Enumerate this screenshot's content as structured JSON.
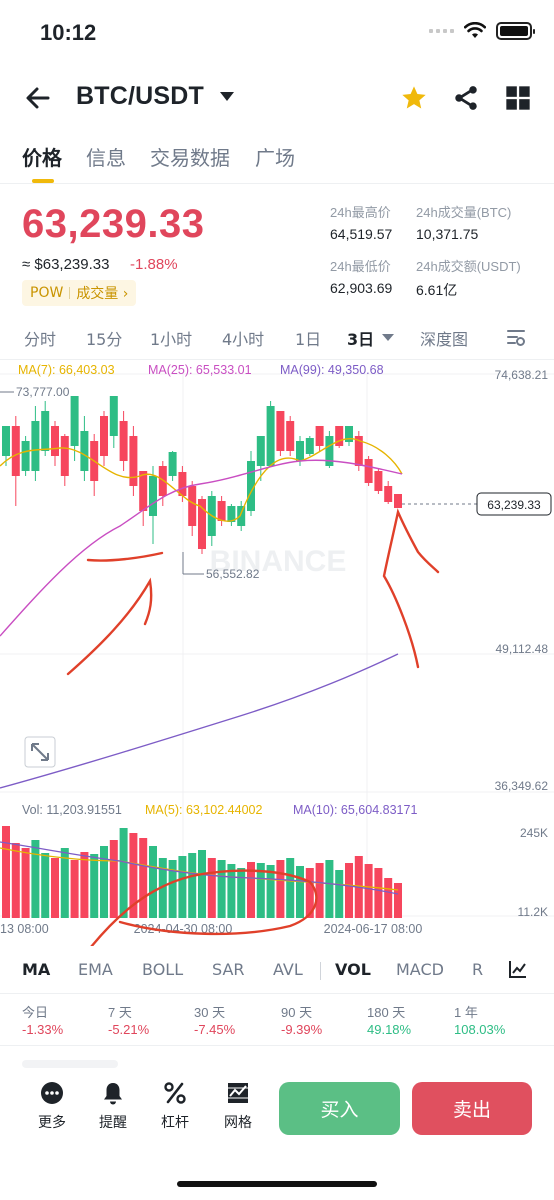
{
  "status": {
    "time": "10:12"
  },
  "header": {
    "pair": "BTC/USDT",
    "star_color": "#f0b90b"
  },
  "tabs": [
    {
      "label": "价格",
      "active": true
    },
    {
      "label": "信息"
    },
    {
      "label": "交易数据"
    },
    {
      "label": "广场"
    }
  ],
  "price": {
    "last": "63,239.33",
    "usd": "≈ $63,239.33",
    "change": "-1.88%",
    "badge_pow": "POW",
    "badge_volume": "成交量 ›",
    "high_label": "24h最高价",
    "high": "64,519.57",
    "low_label": "24h最低价",
    "low": "62,903.69",
    "vol_btc_label": "24h成交量(BTC)",
    "vol_btc": "10,371.75",
    "vol_usdt_label": "24h成交额(USDT)",
    "vol_usdt": "6.61亿"
  },
  "intervals": [
    "分时",
    "15分",
    "1小时",
    "4小时",
    "1日",
    "3日",
    "深度图"
  ],
  "chart": {
    "ma7": "MA(7): 66,403.03",
    "ma25": "MA(25): 65,533.01",
    "ma99": "MA(99): 49,350.68",
    "axis_top": "74,638.21",
    "axis_mid": "49,112.48",
    "axis_bottom": "36,349.62",
    "high_marker": "73,777.00",
    "low_marker": "56,552.82",
    "current": "63,239.33",
    "watermark": "BINANCE",
    "vol": "Vol: 11,203.91551",
    "vol_ma5": "MA(5): 63,102.44002",
    "vol_ma10": "MA(10): 65,604.83171",
    "vol_axis_top": "245K",
    "vol_axis_bottom": "11.2K",
    "date1": "13 08:00",
    "date2": "2024-04-30 08:00",
    "date3": "2024-06-17 08:00",
    "colors": {
      "up": "#2ebd85",
      "down": "#f6465d",
      "ma7": "#e6b400",
      "ma25": "#c94ec2",
      "ma99": "#7d5cc6",
      "annotation": "#e0402a"
    }
  },
  "indicators": [
    "MA",
    "EMA",
    "BOLL",
    "SAR",
    "AVL",
    "VOL",
    "MACD",
    "R"
  ],
  "performance": [
    {
      "label": "今日",
      "value": "-1.33%"
    },
    {
      "label": "7 天",
      "value": "-5.21%"
    },
    {
      "label": "30 天",
      "value": "-7.45%"
    },
    {
      "label": "90 天",
      "value": "-9.39%"
    },
    {
      "label": "180 天",
      "value": "49.18%"
    },
    {
      "label": "1 年",
      "value": "108.03%"
    }
  ],
  "bottom": {
    "more": "更多",
    "alert": "提醒",
    "leverage": "杠杆",
    "grid": "网格",
    "buy": "买入",
    "sell": "卖出"
  }
}
